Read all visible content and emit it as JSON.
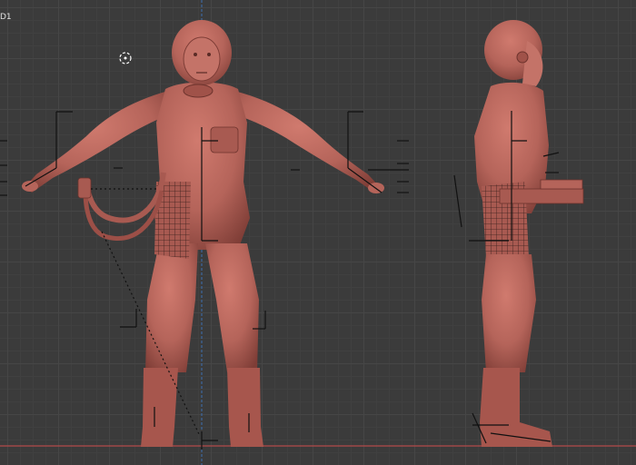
{
  "viewport": {
    "corner_label": "D1",
    "colors": {
      "background": "#3b3b3b",
      "grid_major": "#464646",
      "model": "#b5645a",
      "model_shadow": "#8c463f",
      "floor_line": "#b24a4a",
      "center_axis": "#3d6fb0",
      "rig_lines": "#111111"
    },
    "views": [
      "front-view",
      "side-view"
    ]
  }
}
